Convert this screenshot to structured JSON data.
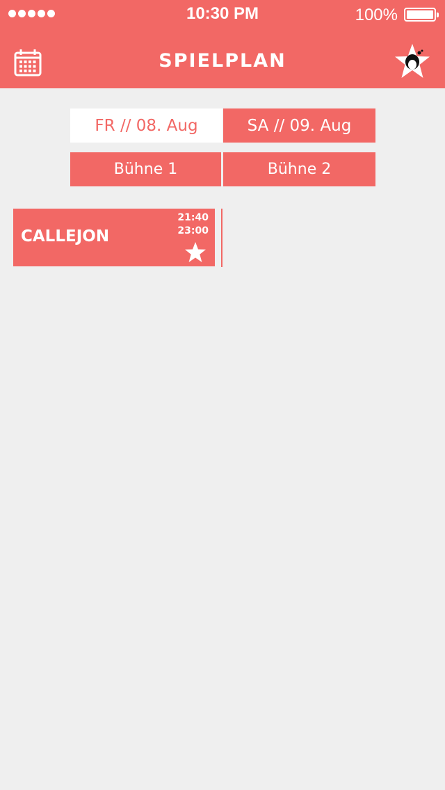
{
  "status_bar": {
    "time": "10:30 PM",
    "battery_percent": "100%",
    "signal_icon": "signal-dots-icon",
    "battery_icon": "battery-full-icon"
  },
  "nav": {
    "title": "SPIELPLAN",
    "left_icon": "calendar-icon",
    "right_icon": "favorites-star-avatar-icon"
  },
  "day_tabs": [
    {
      "label": "FR // 08. Aug",
      "selected": true
    },
    {
      "label": "SA // 09. Aug",
      "selected": false
    }
  ],
  "stage_tabs": [
    {
      "label": "Bühne 1"
    },
    {
      "label": "Bühne 2"
    }
  ],
  "events": [
    {
      "name": "CALLEJON",
      "start": "21:40",
      "end": "23:00",
      "favorite_icon": "star-icon"
    }
  ],
  "colors": {
    "accent": "#f26865",
    "background": "#efefef",
    "text_on_accent": "#ffffff"
  }
}
